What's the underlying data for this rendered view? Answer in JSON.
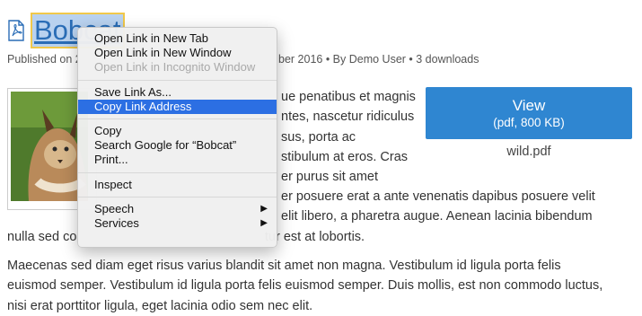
{
  "page": {
    "title": "Bobcat",
    "meta_left": "Published on 27",
    "meta_right": "ber 2016 • By Demo User • 3 downloads",
    "paragraph1_lines": [
      "ue penatibus et magnis",
      "ntes, nascetur ridiculus",
      "sus, porta ac",
      "stibulum at eros. Cras",
      "er purus sit amet"
    ],
    "paragraph2_lines": [
      "er posuere erat a ante venenatis dapibus posuere velit",
      "elit libero, a pharetra augue. Aenean lacinia bibendum",
      "nulla sed co                                                    tur est at lobortis."
    ],
    "paragraph3_lines": [
      "Maecenas sed diam eget risus varius blandit sit amet non magna. Vestibulum id ligula porta felis",
      "euismod semper. Vestibulum id ligula porta felis euismod semper. Duis mollis, est non commodo luctus,",
      "nisi erat porttitor ligula, eget lacinia odio sem nec elit."
    ]
  },
  "download": {
    "view_label": "View",
    "view_sub": "(pdf, 800 KB)",
    "filename": "wild.pdf"
  },
  "context_menu": {
    "items": [
      {
        "label": "Open Link in New Tab"
      },
      {
        "label": "Open Link in New Window"
      },
      {
        "label": "Open Link in Incognito Window",
        "disabled": true
      },
      {
        "label": "Save Link As..."
      },
      {
        "label": "Copy Link Address",
        "highlighted": true
      },
      {
        "label": "Copy"
      },
      {
        "label": "Search Google for “Bobcat”"
      },
      {
        "label": "Print..."
      },
      {
        "label": "Inspect"
      },
      {
        "label": "Speech",
        "submenu": true
      },
      {
        "label": "Services",
        "submenu": true
      }
    ]
  },
  "colors": {
    "link": "#2a6db6",
    "button": "#2f86d1",
    "menu_highlight": "#2c6fe3"
  }
}
